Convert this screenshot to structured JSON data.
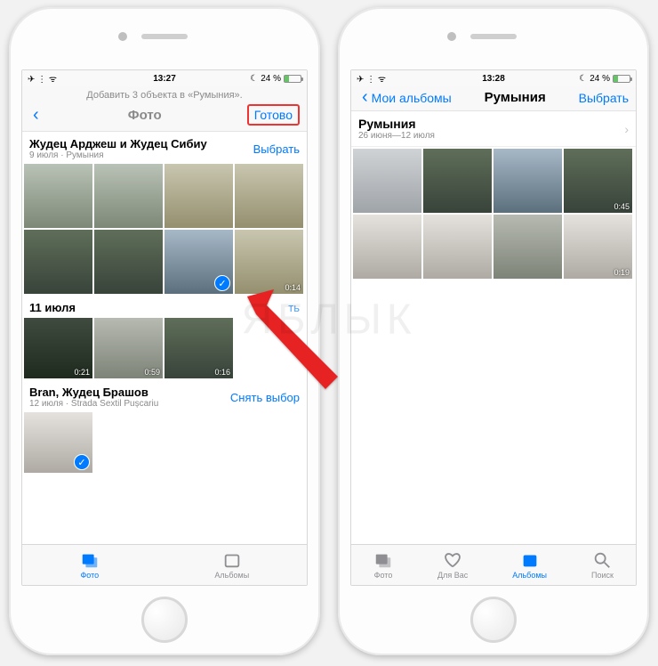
{
  "statusbar": {
    "time_left": "13:27",
    "time_right": "13:28",
    "battery": "24 %"
  },
  "left": {
    "banner": "Добавить 3 объекта в «Румыния».",
    "nav_title": "Фото",
    "done": "Готово",
    "s1_title": "Жудец Арджеш и Жудец Сибиу",
    "s1_sub": "9 июля · Румыния",
    "s1_sel": "Выбрать",
    "v_014": "0:14",
    "s2_title": "11 июля",
    "s2_sel": "ть",
    "v_021": "0:21",
    "v_059": "0:59",
    "v_016": "0:16",
    "s3_title": "Bran, Жудец Брашов",
    "s3_sub": "12 июля · Strada Sextil Pușcariu",
    "s3_sel": "Снять выбор"
  },
  "right": {
    "back": "Мои альбомы",
    "nav_title": "Румыния",
    "select": "Выбрать",
    "album_title": "Румыния",
    "album_sub": "26 июня—12 июля",
    "v_045": "0:45",
    "v_019": "0:19"
  },
  "tabs": {
    "photos": "Фото",
    "foryou": "Для Вас",
    "albums": "Альбомы",
    "search": "Поиск"
  }
}
